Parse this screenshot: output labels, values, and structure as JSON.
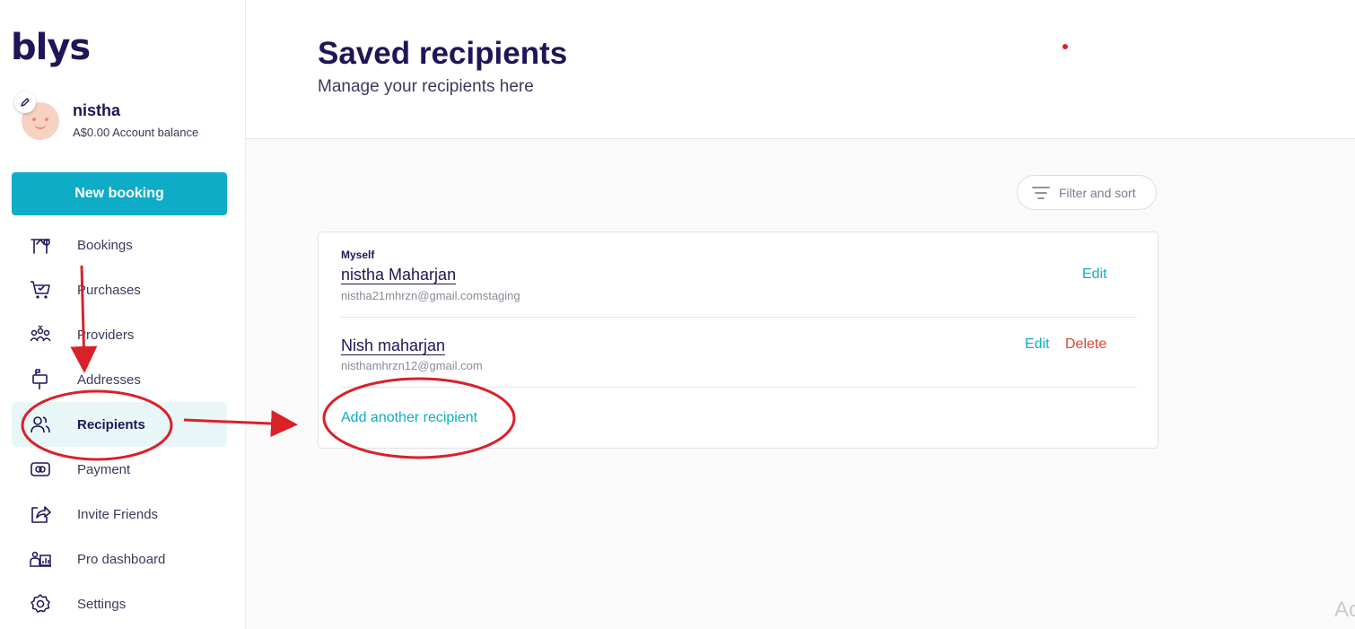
{
  "app": {
    "logo": "blys"
  },
  "profile": {
    "name": "nistha",
    "balance": "A$0.00 Account balance"
  },
  "sidebar": {
    "new_booking_label": "New booking",
    "items": [
      {
        "label": "Bookings",
        "icon": "bookings-icon"
      },
      {
        "label": "Purchases",
        "icon": "cart-icon"
      },
      {
        "label": "Providers",
        "icon": "providers-icon"
      },
      {
        "label": "Addresses",
        "icon": "mailbox-icon"
      },
      {
        "label": "Recipients",
        "icon": "users-icon",
        "active": true
      },
      {
        "label": "Payment",
        "icon": "payment-card-icon"
      },
      {
        "label": "Invite Friends",
        "icon": "share-icon"
      },
      {
        "label": "Pro dashboard",
        "icon": "pro-dashboard-icon"
      },
      {
        "label": "Settings",
        "icon": "gear-icon"
      }
    ]
  },
  "header": {
    "title": "Saved recipients",
    "subtitle": "Manage your recipients here"
  },
  "toolbar": {
    "filter_label": "Filter and sort"
  },
  "recipients": [
    {
      "tag": "Myself",
      "name": "nistha Maharjan",
      "email": "nistha21mhrzn@gmail.comstaging",
      "edit_label": "Edit"
    },
    {
      "name": "Nish maharjan",
      "email": "nisthamhrzn12@gmail.com",
      "edit_label": "Edit",
      "delete_label": "Delete"
    }
  ],
  "add_recipient_label": "Add another recipient",
  "corner_text": "Ac",
  "colors": {
    "brand_navy": "#1e1656",
    "accent_teal": "#0eacc7",
    "delete_red": "#e2452f",
    "annotation_red": "#d9212a"
  }
}
